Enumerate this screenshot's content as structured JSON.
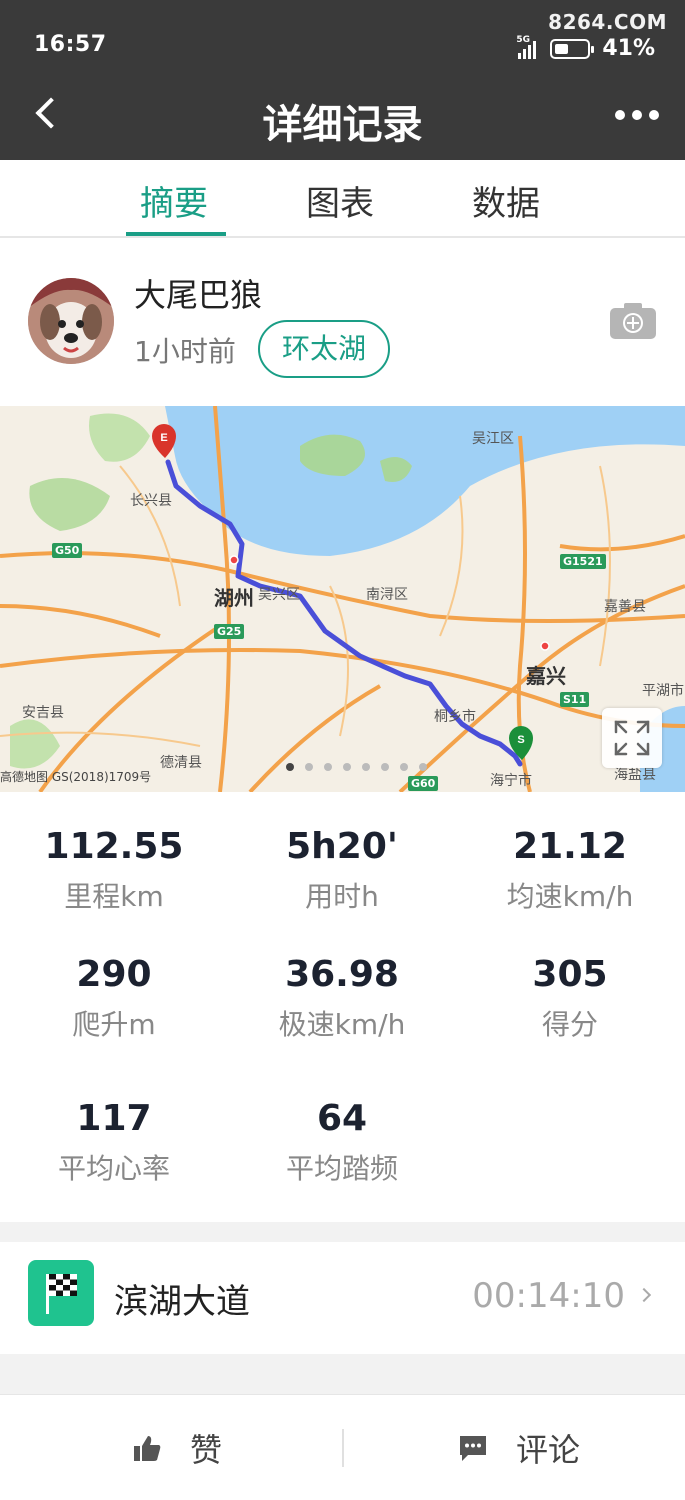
{
  "status_bar": {
    "time": "16:57",
    "network": "5G",
    "battery_percent": 41,
    "battery_text": "41%"
  },
  "watermark": "8264.COM",
  "header": {
    "title": "详细记录"
  },
  "tabs": [
    {
      "label": "摘要",
      "active": true
    },
    {
      "label": "图表",
      "active": false
    },
    {
      "label": "数据",
      "active": false
    }
  ],
  "profile": {
    "username": "大尾巴狼",
    "time_ago": "1小时前",
    "tag": "环太湖"
  },
  "map": {
    "labels": {
      "wujiang": "吴江区",
      "changxing": "长兴县",
      "huzhou": "湖州",
      "wuxing": "吴兴区",
      "nanxun": "南浔区",
      "jiaxing": "嘉兴",
      "jiashan": "嘉善县",
      "pinghu": "平湖市",
      "anji": "安吉县",
      "deqing": "德清县",
      "tongxiang": "桐乡市",
      "haining": "海宁市",
      "haiyan": "海盐县"
    },
    "shields": {
      "g50": "G50",
      "g25": "G25",
      "g1521": "G1521",
      "s11": "S11",
      "g60": "G60"
    },
    "credit": "高德地图 GS(2018)1709号",
    "start_marker": "S",
    "end_marker": "E",
    "page_dots": 8,
    "active_dot": 0
  },
  "stats": [
    {
      "value": "112.55",
      "label": "里程km"
    },
    {
      "value": "5h20'",
      "label": "用时h"
    },
    {
      "value": "21.12",
      "label": "均速km/h"
    },
    {
      "value": "290",
      "label": "爬升m"
    },
    {
      "value": "36.98",
      "label": "极速km/h"
    },
    {
      "value": "305",
      "label": "得分"
    },
    {
      "value": "117",
      "label": "平均心率"
    },
    {
      "value": "64",
      "label": "平均踏频"
    }
  ],
  "segment": {
    "name": "滨湖大道",
    "time": "00:14:10"
  },
  "bottom": {
    "like_label": "赞",
    "comment_label": "评论"
  },
  "colors": {
    "accent": "#1a9e86",
    "header_bg": "#3a3a3a",
    "route": "#4a4fd8",
    "segment_icon": "#1fc38f"
  }
}
